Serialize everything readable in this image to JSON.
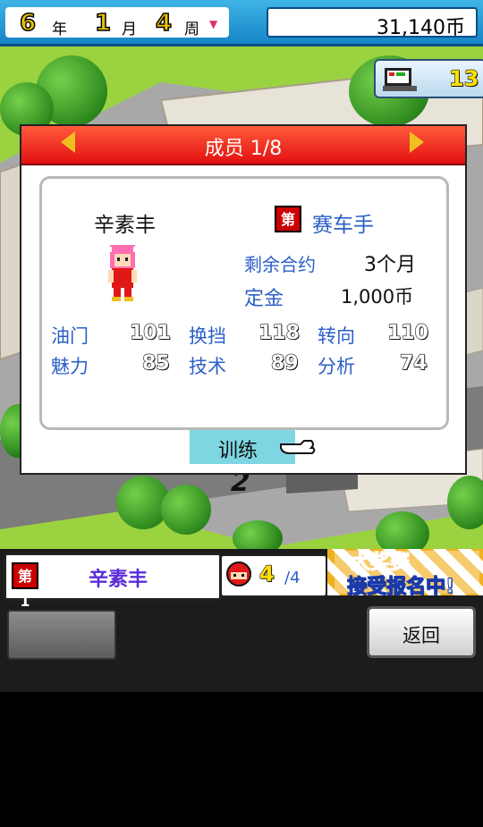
{
  "topbar": {
    "year": "6",
    "year_label": "年",
    "month": "1",
    "month_label": "月",
    "week": "4",
    "week_label": "周",
    "money": "31,140币"
  },
  "tv_badge": {
    "count": "13"
  },
  "dialog": {
    "title": "成员 1/8",
    "member": {
      "name": "辛素丰",
      "rank_badge": "第1",
      "role": "赛车手",
      "contract_label": "剩余合约",
      "contract_value": "3个月",
      "deposit_label": "定金",
      "deposit_value": "1,000币"
    },
    "stats": [
      {
        "label": "油门",
        "value": "101"
      },
      {
        "label": "换挡",
        "value": "118"
      },
      {
        "label": "转向",
        "value": "110"
      },
      {
        "label": "魅力",
        "value": "85"
      },
      {
        "label": "技术",
        "value": "89"
      },
      {
        "label": "分析",
        "value": "74"
      }
    ],
    "train_label": "训练"
  },
  "map": {
    "parking_number": "2"
  },
  "bottom": {
    "rank_badge": "第1",
    "driver_name": "辛素丰",
    "count": "4",
    "count_total": "/4",
    "promo_line1": "大奖赛",
    "promo_line2": "接受报名中!",
    "back_label": "返回"
  },
  "colors": {
    "accent_blue": "#2c5fc8",
    "header_red": "#e21010",
    "top_blue": "#1684c6"
  }
}
